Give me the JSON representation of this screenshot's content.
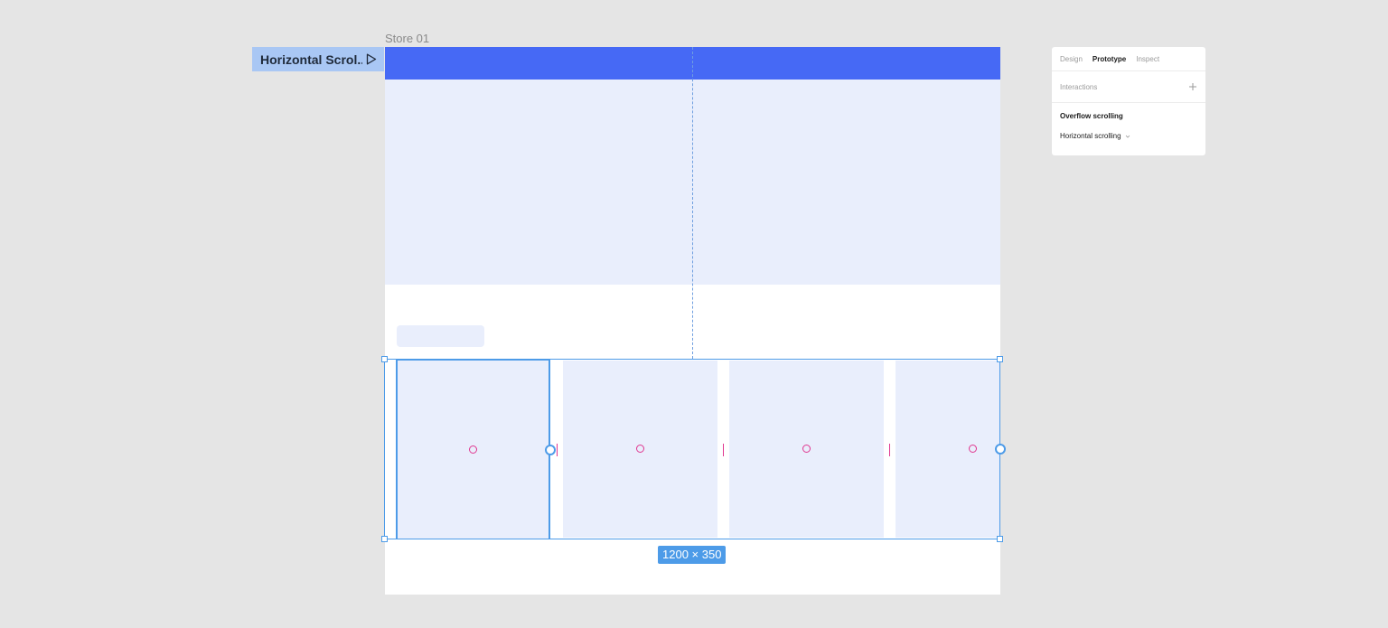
{
  "frame": {
    "name": "Store 01",
    "selected_layer": "Horizontal Scrol...",
    "dimensions": "1200 × 350"
  },
  "strip": {
    "cards": [
      {
        "selected": true
      },
      {
        "selected": false
      },
      {
        "selected": false
      },
      {
        "selected": false
      }
    ]
  },
  "panel": {
    "tabs": [
      {
        "label": "Design",
        "active": false
      },
      {
        "label": "Prototype",
        "active": true
      },
      {
        "label": "Inspect",
        "active": false
      }
    ],
    "interactions_label": "Interactions",
    "overflow_title": "Overflow scrolling",
    "overflow_value": "Horizontal scrolling"
  },
  "colors": {
    "accent": "#4669f5",
    "selection": "#4d9be8",
    "card_fill": "#e9eefc",
    "spacing_marker": "#e0368f",
    "canvas": "#e5e5e5"
  },
  "icons": {
    "play": "play-outline-icon",
    "add": "plus-icon",
    "chevron": "chevron-down-icon"
  }
}
